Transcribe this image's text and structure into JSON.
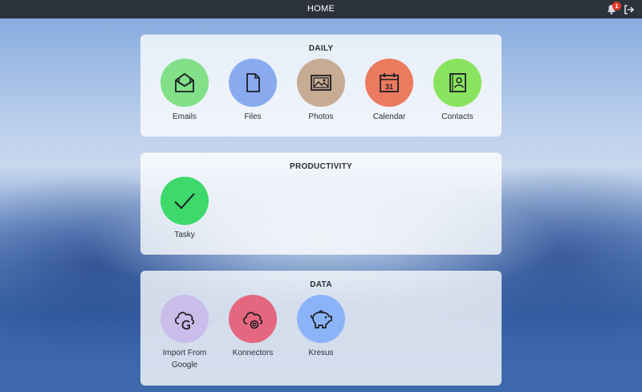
{
  "topbar": {
    "title": "HOME",
    "notification_count": "1",
    "icons": [
      "bell-icon",
      "logout-icon"
    ]
  },
  "sections": [
    {
      "title": "DAILY",
      "apps": [
        {
          "label": "Emails",
          "color": "#82e089",
          "icon": "envelope-icon"
        },
        {
          "label": "Files",
          "color": "#8aaaf0",
          "icon": "file-icon"
        },
        {
          "label": "Photos",
          "color": "#c8ab93",
          "icon": "image-icon"
        },
        {
          "label": "Calendar",
          "color": "#ec7a5e",
          "icon": "calendar-icon",
          "icon_text": "31"
        },
        {
          "label": "Contacts",
          "color": "#8ae35e",
          "icon": "contact-book-icon"
        }
      ]
    },
    {
      "title": "PRODUCTIVITY",
      "apps": [
        {
          "label": "Tasky",
          "color": "#3dd96b",
          "icon": "checkmark-icon"
        }
      ]
    },
    {
      "title": "DATA",
      "apps": [
        {
          "label": "Import From Google",
          "color": "#cabdea",
          "icon": "cloud-google-icon"
        },
        {
          "label": "Konnectors",
          "color": "#e5667f",
          "icon": "cloud-connector-icon"
        },
        {
          "label": "Kresus",
          "color": "#8bb4f8",
          "icon": "piggy-bank-icon"
        }
      ]
    }
  ]
}
